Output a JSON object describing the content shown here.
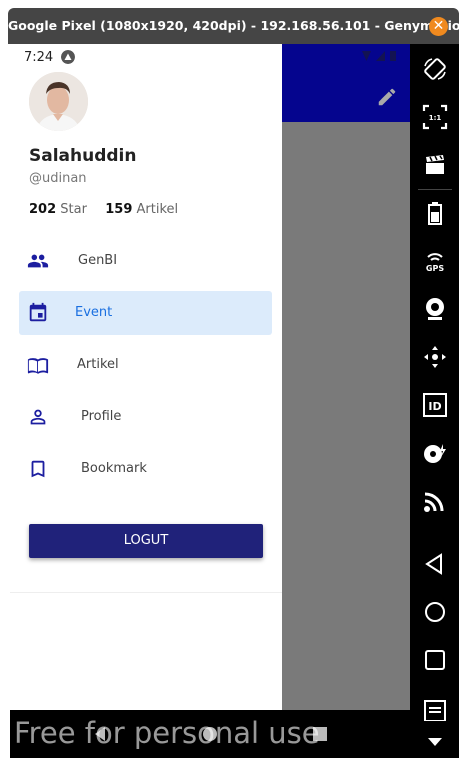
{
  "window": {
    "title": "Google Pixel (1080x1920, 420dpi) - 192.168.56.101 - Genymotion",
    "close_glyph": "✕"
  },
  "status_bar": {
    "time": "7:24"
  },
  "profile": {
    "name": "Salahuddin",
    "handle": "@udinan",
    "stars_count": "202",
    "stars_label": "Star",
    "articles_count": "159",
    "articles_label": "Artikel"
  },
  "menu": {
    "items": [
      {
        "label": "GenBI",
        "icon": "group-icon"
      },
      {
        "label": "Event",
        "icon": "calendar-icon",
        "active": true
      },
      {
        "label": "Artikel",
        "icon": "book-icon"
      },
      {
        "label": "Profile",
        "icon": "person-icon"
      },
      {
        "label": "Bookmark",
        "icon": "bookmark-icon"
      }
    ]
  },
  "logout_label": "LOGUT",
  "watermark": "Free for personal use",
  "colors": {
    "appbar": "#05058e",
    "active_item_bg": "#dcebfb",
    "active_item_text": "#1a6fe0",
    "icon": "#1c1ea0",
    "logout_button": "#20227a"
  },
  "sidepanel_tools": [
    "rotate-icon",
    "pixel-perfect-icon",
    "clapperboard-icon",
    "battery-icon",
    "gps-icon",
    "webcam-icon",
    "dpad-icon",
    "id-icon",
    "disk-icon",
    "cast-icon",
    "back-icon",
    "home-icon",
    "recents-icon",
    "menu-icon",
    "scroll-down-icon"
  ]
}
